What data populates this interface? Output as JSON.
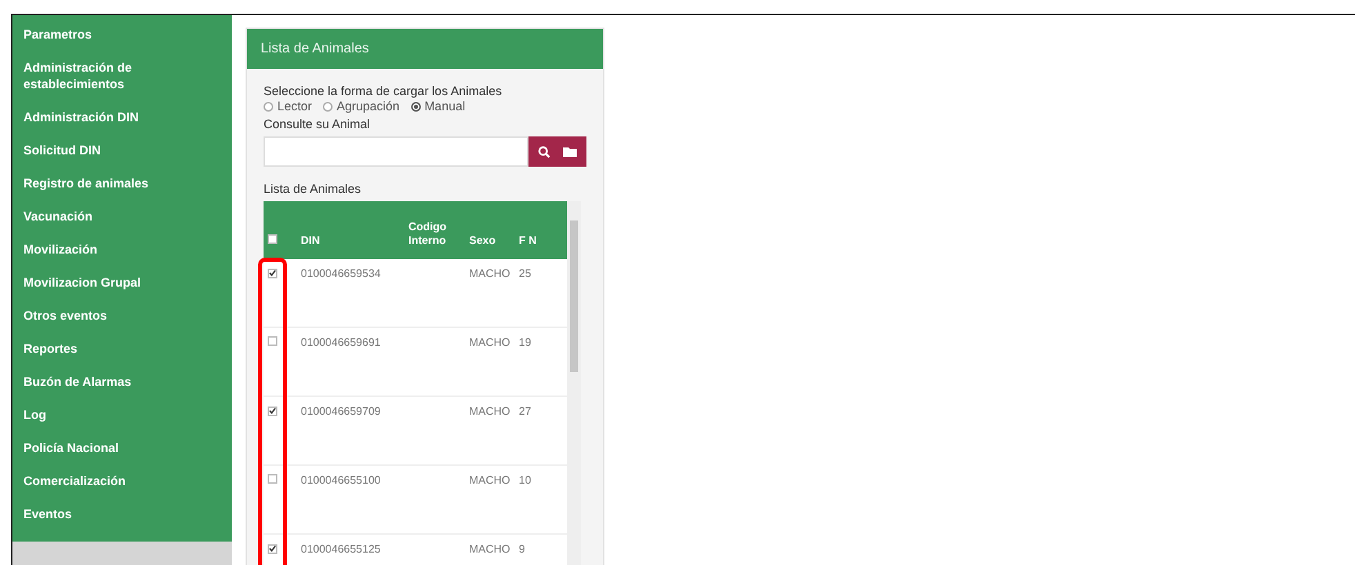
{
  "sidebar": {
    "items": [
      {
        "label": "Parametros"
      },
      {
        "label": "Administración de establecimientos"
      },
      {
        "label": "Administración DIN"
      },
      {
        "label": "Solicitud DIN"
      },
      {
        "label": "Registro de animales"
      },
      {
        "label": "Vacunación"
      },
      {
        "label": "Movilización"
      },
      {
        "label": "Movilizacion Grupal"
      },
      {
        "label": "Otros eventos"
      },
      {
        "label": "Reportes"
      },
      {
        "label": "Buzón de Alarmas"
      },
      {
        "label": "Log"
      },
      {
        "label": "Policía Nacional"
      },
      {
        "label": "Comercialización"
      },
      {
        "label": "Eventos"
      }
    ]
  },
  "panel": {
    "title": "Lista de Animales",
    "load_label": "Seleccione la forma de cargar los Animales",
    "load_options": [
      {
        "label": "Lector",
        "selected": false
      },
      {
        "label": "Agrupación",
        "selected": false
      },
      {
        "label": "Manual",
        "selected": true
      }
    ],
    "search_label": "Consulte su Animal",
    "list_label": "Lista de Animales",
    "table": {
      "select_all_checked": false,
      "columns": [
        "DIN",
        "Codigo Interno",
        "Sexo",
        "F N"
      ],
      "rows": [
        {
          "checked": true,
          "cells": [
            "0100046659534",
            "",
            "MACHO",
            "25"
          ]
        },
        {
          "checked": false,
          "cells": [
            "0100046659691",
            "",
            "MACHO",
            "19"
          ]
        },
        {
          "checked": true,
          "cells": [
            "0100046659709",
            "",
            "MACHO",
            "27"
          ]
        },
        {
          "checked": false,
          "cells": [
            "0100046655100",
            "",
            "MACHO",
            "10"
          ]
        },
        {
          "checked": true,
          "cells": [
            "0100046655125",
            "",
            "MACHO",
            "9"
          ]
        }
      ]
    }
  }
}
